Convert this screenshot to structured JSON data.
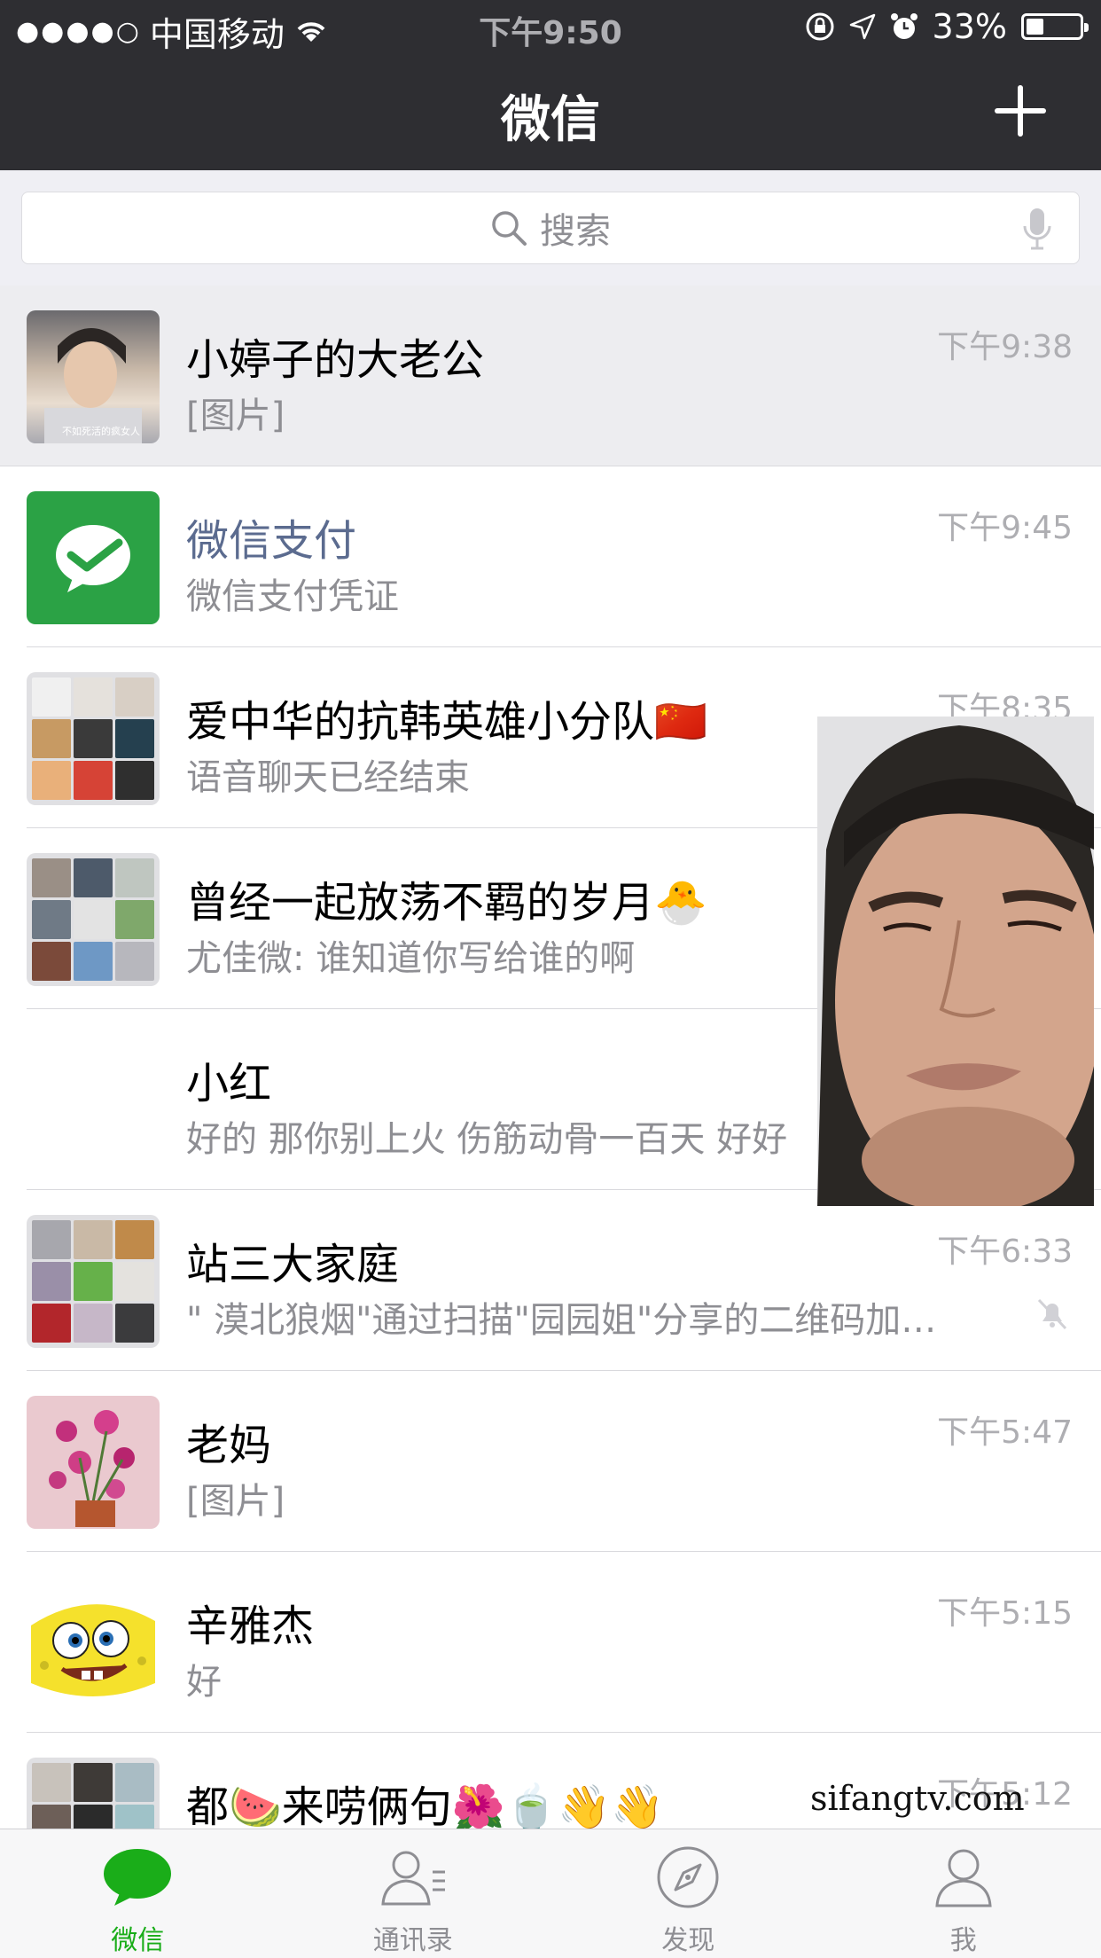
{
  "status_bar": {
    "carrier": "中国移动",
    "time": "下午9:50",
    "battery": "33%",
    "battery_level": 0.33
  },
  "nav": {
    "title": "微信"
  },
  "search": {
    "placeholder": "搜索"
  },
  "chats": [
    {
      "name": "小婷子的大老公",
      "preview": "[图片]",
      "time": "下午9:38",
      "avatar_caption": "不如死活的疯女人",
      "pinned": true
    },
    {
      "name": "微信支付",
      "preview": "微信支付凭证",
      "time": "下午9:45"
    },
    {
      "name": "爱中华的抗韩英雄小分队🇨🇳",
      "preview": "语音聊天已经结束",
      "time": "下午8:35"
    },
    {
      "name": "曾经一起放荡不羁的岁月🐣",
      "preview": "尤佳微: 谁知道你写给谁的啊",
      "time": ""
    },
    {
      "name": "小红",
      "preview": "好的 那你别上火 伤筋动骨一百天 好好",
      "time": ""
    },
    {
      "name": "站三大家庭",
      "preview": "\" 漠北狼烟\"通过扫描\"园园姐\"分享的二维码加…",
      "time": "下午6:33",
      "muted": true
    },
    {
      "name": "老妈",
      "preview": "[图片]",
      "time": "下午5:47"
    },
    {
      "name": "辛雅杰",
      "preview": "好",
      "time": "下午5:15"
    },
    {
      "name": "都🍉来唠俩句🌺🍵👋👋",
      "preview": "",
      "time": "下午5:12"
    }
  ],
  "tabs": [
    {
      "label": "微信",
      "icon": "chat-bubble-icon",
      "active": true
    },
    {
      "label": "通讯录",
      "icon": "contacts-icon"
    },
    {
      "label": "发现",
      "icon": "compass-icon"
    },
    {
      "label": "我",
      "icon": "person-icon"
    }
  ],
  "watermark": "sifangtv.com",
  "colors": {
    "nav_bg": "#2e2e32",
    "accent": "#1aad19",
    "pay_green": "#2ba245"
  }
}
